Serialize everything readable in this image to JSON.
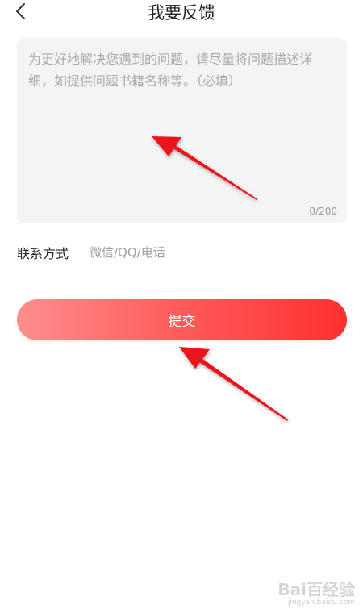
{
  "header": {
    "title": "我要反馈",
    "back_icon": "chevron-left-icon"
  },
  "feedback": {
    "placeholder": "为更好地解决您遇到的问题，请尽量将问题描述详细，如提供问题书籍名称等。（必填）",
    "value": "",
    "counter": "0/200"
  },
  "contact": {
    "label": "联系方式",
    "placeholder": "微信/QQ/电话",
    "value": ""
  },
  "submit": {
    "label": "提交",
    "gradient_start": "#ff8e8e",
    "gradient_end": "#ff2f2f"
  },
  "annotation": {
    "arrow_color": "#e8141c"
  },
  "watermark": {
    "logo": "Bai百经验",
    "sub": "jingyan.baidu.com"
  }
}
